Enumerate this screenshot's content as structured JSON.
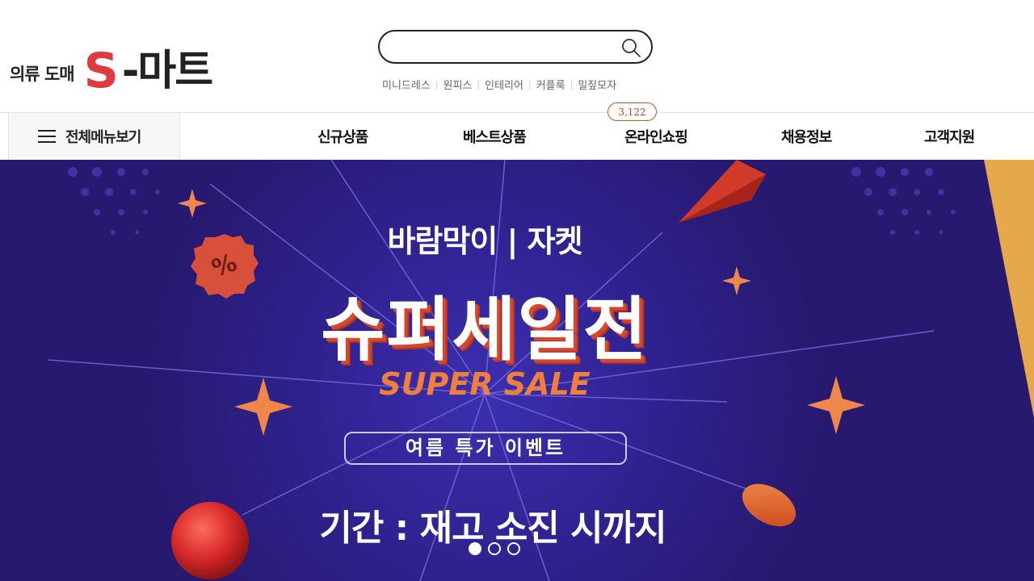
{
  "header": {
    "logo_sub": "의류 도매",
    "logo_s": "S",
    "logo_main": "-마트",
    "search": {
      "placeholder": "",
      "value": ""
    },
    "keywords": [
      "미니드레스",
      "원피스",
      "인테리어",
      "커플룩",
      "밀짚모자"
    ]
  },
  "nav": {
    "all_menu_label": "전체메뉴보기",
    "items": [
      "신규상품",
      "베스트상품",
      "온라인쇼핑",
      "채용정보",
      "고객지원"
    ],
    "badge": "3,122"
  },
  "banner": {
    "subtitle": "바람막이 | 자켓",
    "title": "슈퍼세일전",
    "title_en": "SUPER SALE",
    "event_label": "여름 특가 이벤트",
    "period": "기간 : 재고 소진 시까지",
    "percent_badge": "%",
    "slides_total": 3,
    "active_slide": 1
  },
  "colors": {
    "brand_red": "#e0393e",
    "banner_bg": "#2b1d7c",
    "accent_orange": "#ef7f3a",
    "badge_orange": "#d9531e"
  }
}
